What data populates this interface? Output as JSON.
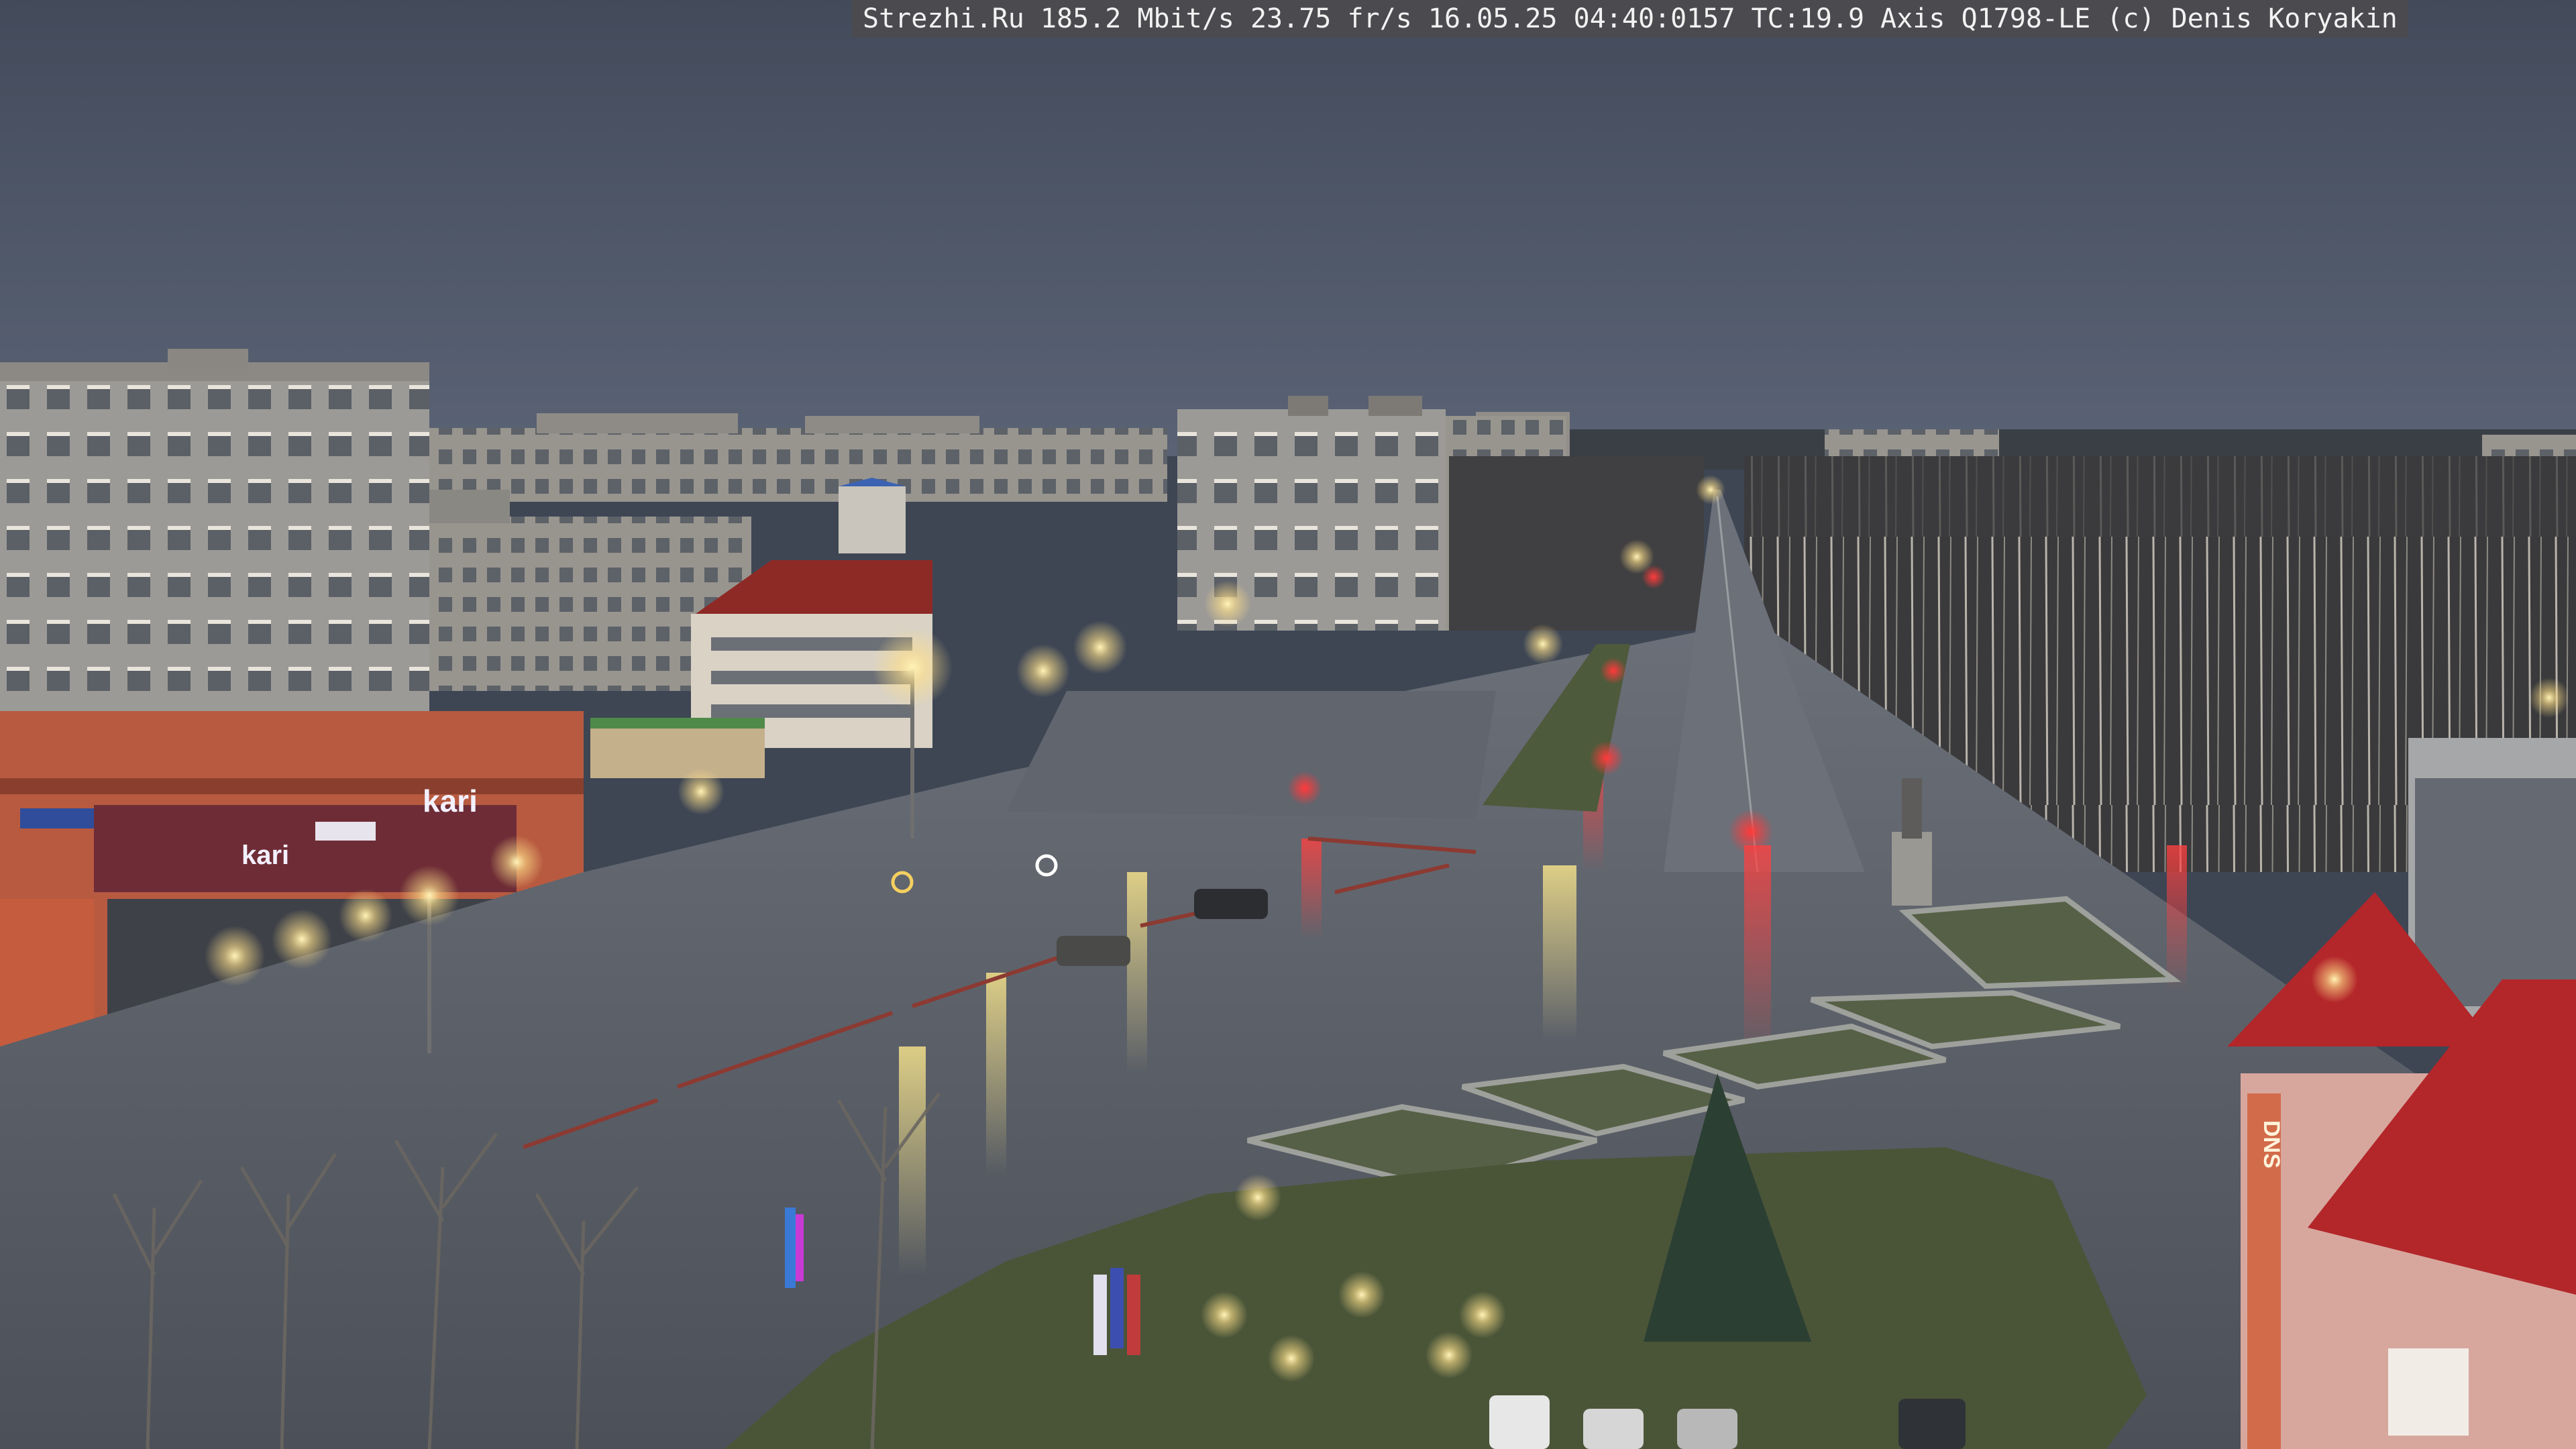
{
  "overlay": {
    "caption": "Strezhi.Ru 185.2 Mbit/s 23.75 fr/s 16.05.25 04:40:0157 TC:19.9  Axis Q1798-LE  (c) Denis Koryakin"
  },
  "scene": {
    "store_signs": {
      "left_sign": "kari",
      "mid_sign": "kari",
      "dns_sign": "DNS"
    },
    "colors": {
      "sky": "#4a5466",
      "road_wet": "#5a606a",
      "brick_building": "#b85a40",
      "roof_red": "#b3262a",
      "street_light": "#ffe9a0",
      "traffic_red": "#ff2a2a"
    }
  }
}
